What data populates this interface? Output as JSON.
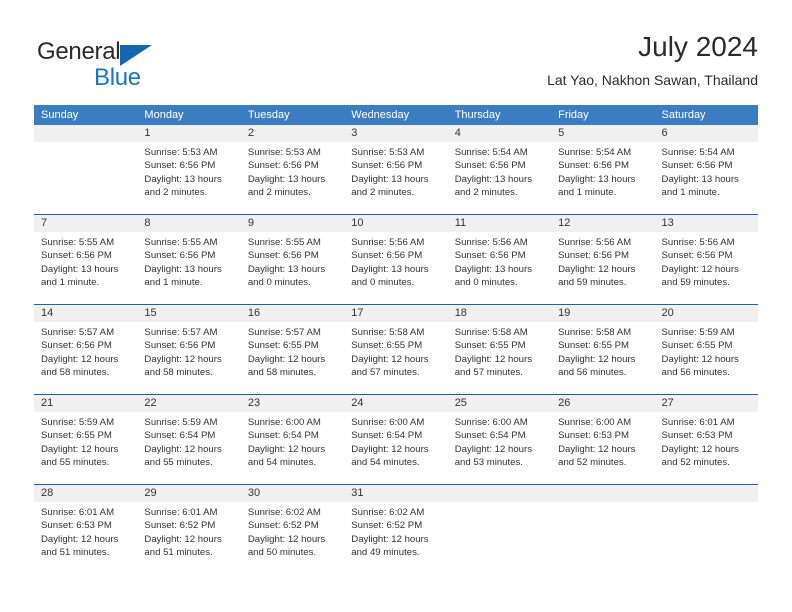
{
  "brand": {
    "name_top": "General",
    "name_bottom": "Blue",
    "color_top": "#2b2b2b",
    "color_bottom": "#1874cd",
    "triangle_color": "#1565b0"
  },
  "header": {
    "title": "July 2024",
    "subtitle": "Lat Yao, Nakhon Sawan, Thailand"
  },
  "theme": {
    "header_row_bg": "#3b7dc0",
    "header_row_text": "#ffffff",
    "row_divider": "#1f5fa8",
    "day_number_bg": "#f0f0f0",
    "body_text": "#333333"
  },
  "calendar": {
    "weekdays": [
      "Sunday",
      "Monday",
      "Tuesday",
      "Wednesday",
      "Thursday",
      "Friday",
      "Saturday"
    ],
    "weeks": [
      [
        {
          "day": "",
          "sunrise": "",
          "sunset": "",
          "daylight_1": "",
          "daylight_2": ""
        },
        {
          "day": "1",
          "sunrise": "Sunrise: 5:53 AM",
          "sunset": "Sunset: 6:56 PM",
          "daylight_1": "Daylight: 13 hours",
          "daylight_2": "and 2 minutes."
        },
        {
          "day": "2",
          "sunrise": "Sunrise: 5:53 AM",
          "sunset": "Sunset: 6:56 PM",
          "daylight_1": "Daylight: 13 hours",
          "daylight_2": "and 2 minutes."
        },
        {
          "day": "3",
          "sunrise": "Sunrise: 5:53 AM",
          "sunset": "Sunset: 6:56 PM",
          "daylight_1": "Daylight: 13 hours",
          "daylight_2": "and 2 minutes."
        },
        {
          "day": "4",
          "sunrise": "Sunrise: 5:54 AM",
          "sunset": "Sunset: 6:56 PM",
          "daylight_1": "Daylight: 13 hours",
          "daylight_2": "and 2 minutes."
        },
        {
          "day": "5",
          "sunrise": "Sunrise: 5:54 AM",
          "sunset": "Sunset: 6:56 PM",
          "daylight_1": "Daylight: 13 hours",
          "daylight_2": "and 1 minute."
        },
        {
          "day": "6",
          "sunrise": "Sunrise: 5:54 AM",
          "sunset": "Sunset: 6:56 PM",
          "daylight_1": "Daylight: 13 hours",
          "daylight_2": "and 1 minute."
        }
      ],
      [
        {
          "day": "7",
          "sunrise": "Sunrise: 5:55 AM",
          "sunset": "Sunset: 6:56 PM",
          "daylight_1": "Daylight: 13 hours",
          "daylight_2": "and 1 minute."
        },
        {
          "day": "8",
          "sunrise": "Sunrise: 5:55 AM",
          "sunset": "Sunset: 6:56 PM",
          "daylight_1": "Daylight: 13 hours",
          "daylight_2": "and 1 minute."
        },
        {
          "day": "9",
          "sunrise": "Sunrise: 5:55 AM",
          "sunset": "Sunset: 6:56 PM",
          "daylight_1": "Daylight: 13 hours",
          "daylight_2": "and 0 minutes."
        },
        {
          "day": "10",
          "sunrise": "Sunrise: 5:56 AM",
          "sunset": "Sunset: 6:56 PM",
          "daylight_1": "Daylight: 13 hours",
          "daylight_2": "and 0 minutes."
        },
        {
          "day": "11",
          "sunrise": "Sunrise: 5:56 AM",
          "sunset": "Sunset: 6:56 PM",
          "daylight_1": "Daylight: 13 hours",
          "daylight_2": "and 0 minutes."
        },
        {
          "day": "12",
          "sunrise": "Sunrise: 5:56 AM",
          "sunset": "Sunset: 6:56 PM",
          "daylight_1": "Daylight: 12 hours",
          "daylight_2": "and 59 minutes."
        },
        {
          "day": "13",
          "sunrise": "Sunrise: 5:56 AM",
          "sunset": "Sunset: 6:56 PM",
          "daylight_1": "Daylight: 12 hours",
          "daylight_2": "and 59 minutes."
        }
      ],
      [
        {
          "day": "14",
          "sunrise": "Sunrise: 5:57 AM",
          "sunset": "Sunset: 6:56 PM",
          "daylight_1": "Daylight: 12 hours",
          "daylight_2": "and 58 minutes."
        },
        {
          "day": "15",
          "sunrise": "Sunrise: 5:57 AM",
          "sunset": "Sunset: 6:56 PM",
          "daylight_1": "Daylight: 12 hours",
          "daylight_2": "and 58 minutes."
        },
        {
          "day": "16",
          "sunrise": "Sunrise: 5:57 AM",
          "sunset": "Sunset: 6:55 PM",
          "daylight_1": "Daylight: 12 hours",
          "daylight_2": "and 58 minutes."
        },
        {
          "day": "17",
          "sunrise": "Sunrise: 5:58 AM",
          "sunset": "Sunset: 6:55 PM",
          "daylight_1": "Daylight: 12 hours",
          "daylight_2": "and 57 minutes."
        },
        {
          "day": "18",
          "sunrise": "Sunrise: 5:58 AM",
          "sunset": "Sunset: 6:55 PM",
          "daylight_1": "Daylight: 12 hours",
          "daylight_2": "and 57 minutes."
        },
        {
          "day": "19",
          "sunrise": "Sunrise: 5:58 AM",
          "sunset": "Sunset: 6:55 PM",
          "daylight_1": "Daylight: 12 hours",
          "daylight_2": "and 56 minutes."
        },
        {
          "day": "20",
          "sunrise": "Sunrise: 5:59 AM",
          "sunset": "Sunset: 6:55 PM",
          "daylight_1": "Daylight: 12 hours",
          "daylight_2": "and 56 minutes."
        }
      ],
      [
        {
          "day": "21",
          "sunrise": "Sunrise: 5:59 AM",
          "sunset": "Sunset: 6:55 PM",
          "daylight_1": "Daylight: 12 hours",
          "daylight_2": "and 55 minutes."
        },
        {
          "day": "22",
          "sunrise": "Sunrise: 5:59 AM",
          "sunset": "Sunset: 6:54 PM",
          "daylight_1": "Daylight: 12 hours",
          "daylight_2": "and 55 minutes."
        },
        {
          "day": "23",
          "sunrise": "Sunrise: 6:00 AM",
          "sunset": "Sunset: 6:54 PM",
          "daylight_1": "Daylight: 12 hours",
          "daylight_2": "and 54 minutes."
        },
        {
          "day": "24",
          "sunrise": "Sunrise: 6:00 AM",
          "sunset": "Sunset: 6:54 PM",
          "daylight_1": "Daylight: 12 hours",
          "daylight_2": "and 54 minutes."
        },
        {
          "day": "25",
          "sunrise": "Sunrise: 6:00 AM",
          "sunset": "Sunset: 6:54 PM",
          "daylight_1": "Daylight: 12 hours",
          "daylight_2": "and 53 minutes."
        },
        {
          "day": "26",
          "sunrise": "Sunrise: 6:00 AM",
          "sunset": "Sunset: 6:53 PM",
          "daylight_1": "Daylight: 12 hours",
          "daylight_2": "and 52 minutes."
        },
        {
          "day": "27",
          "sunrise": "Sunrise: 6:01 AM",
          "sunset": "Sunset: 6:53 PM",
          "daylight_1": "Daylight: 12 hours",
          "daylight_2": "and 52 minutes."
        }
      ],
      [
        {
          "day": "28",
          "sunrise": "Sunrise: 6:01 AM",
          "sunset": "Sunset: 6:53 PM",
          "daylight_1": "Daylight: 12 hours",
          "daylight_2": "and 51 minutes."
        },
        {
          "day": "29",
          "sunrise": "Sunrise: 6:01 AM",
          "sunset": "Sunset: 6:52 PM",
          "daylight_1": "Daylight: 12 hours",
          "daylight_2": "and 51 minutes."
        },
        {
          "day": "30",
          "sunrise": "Sunrise: 6:02 AM",
          "sunset": "Sunset: 6:52 PM",
          "daylight_1": "Daylight: 12 hours",
          "daylight_2": "and 50 minutes."
        },
        {
          "day": "31",
          "sunrise": "Sunrise: 6:02 AM",
          "sunset": "Sunset: 6:52 PM",
          "daylight_1": "Daylight: 12 hours",
          "daylight_2": "and 49 minutes."
        },
        {
          "day": "",
          "sunrise": "",
          "sunset": "",
          "daylight_1": "",
          "daylight_2": ""
        },
        {
          "day": "",
          "sunrise": "",
          "sunset": "",
          "daylight_1": "",
          "daylight_2": ""
        },
        {
          "day": "",
          "sunrise": "",
          "sunset": "",
          "daylight_1": "",
          "daylight_2": ""
        }
      ]
    ]
  }
}
